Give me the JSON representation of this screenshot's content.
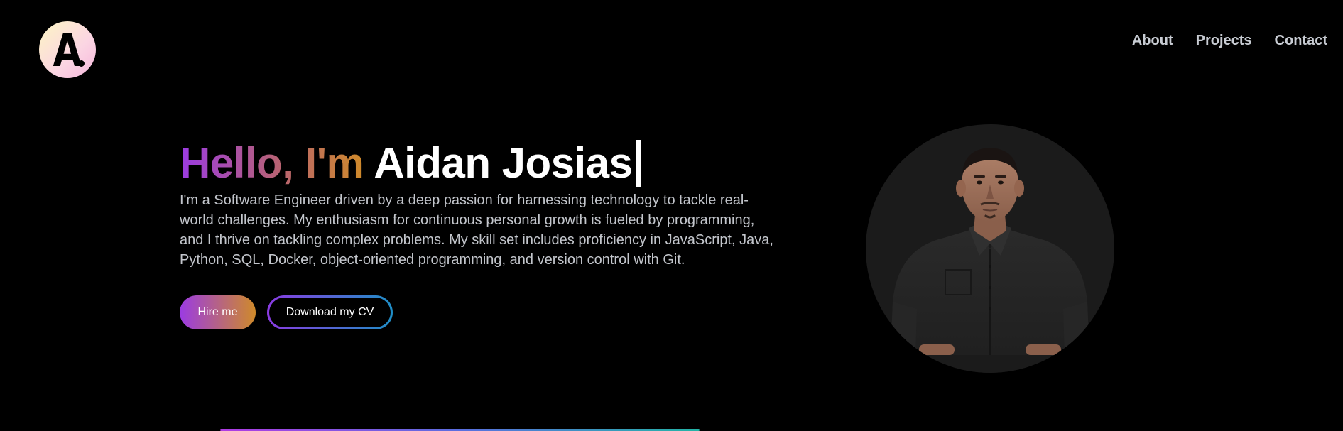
{
  "logo": {
    "letter": "A",
    "colors": {
      "start": "#fdf6c3",
      "end": "#f6b7dc"
    }
  },
  "nav": {
    "items": [
      {
        "label": "About"
      },
      {
        "label": "Projects"
      },
      {
        "label": "Contact"
      }
    ]
  },
  "hero": {
    "greeting": "Hello, I'm",
    "name": "Aidan Josias",
    "bio": "I'm a Software Engineer driven by a deep passion for harnessing technology to tackle real-world challenges. My enthusiasm for continuous personal growth is fueled by programming, and I thrive on tackling complex problems. My skill set includes proficiency in JavaScript, Java, Python, SQL, Docker, object-oriented programming, and version control with Git.",
    "buttons": {
      "hire": "Hire me",
      "cv": "Download my CV"
    }
  },
  "colors": {
    "background": "#000000",
    "nav_text": "#c8ccd3",
    "bio_text": "#c3c6cc",
    "gradient_purple": "#9b3be3",
    "gradient_orange": "#cf8a2a",
    "gradient_blue": "#1f8fc7"
  },
  "icons": {
    "logo": "letter-a-logo",
    "portrait": "profile-photo"
  }
}
